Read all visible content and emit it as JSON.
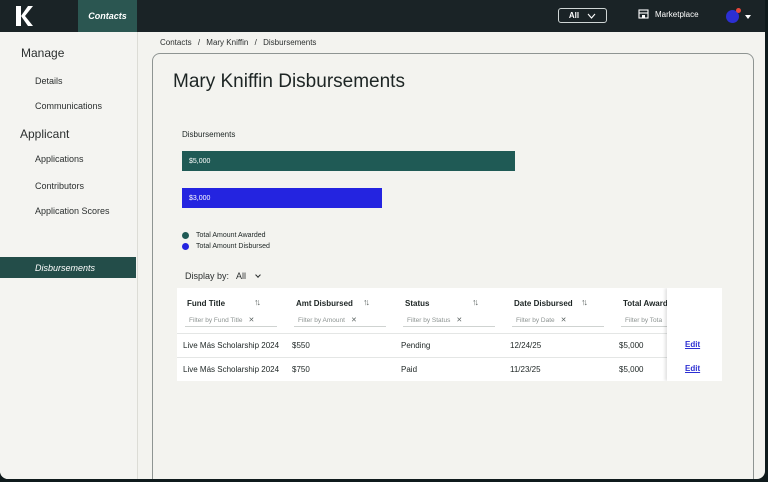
{
  "topbar": {
    "nav_contacts": "Contacts",
    "scope_select": "All",
    "marketplace": "Marketplace"
  },
  "sidebar": {
    "sections": [
      {
        "heading": "Manage",
        "items": [
          "Details",
          "Communications"
        ]
      },
      {
        "heading": "Applicant",
        "items": [
          "Applications",
          "Contributors",
          "Application Scores"
        ]
      }
    ],
    "active_item": "Disbursements"
  },
  "breadcrumb": [
    "Contacts",
    "Mary Kniffin",
    "Disbursements"
  ],
  "breadcrumb_sep": "/",
  "page": {
    "title": "Mary Kniffin Disbursements"
  },
  "chart_data": {
    "type": "bar",
    "orientation": "horizontal",
    "title": "Disbursements",
    "categories": [
      "Total Amount Awarded",
      "Total Amount Disbursed"
    ],
    "values": [
      5000,
      3000
    ],
    "value_labels": [
      "$5,000",
      "$3,000"
    ],
    "colors": [
      "#1f5a55",
      "#2424e0"
    ],
    "legend_position": "bottom-left"
  },
  "display_by": {
    "label": "Display by:",
    "value": "All"
  },
  "table": {
    "columns": [
      {
        "label": "Fund Title",
        "filter": "Filter by Fund Title"
      },
      {
        "label": "Amt Disbursed",
        "filter": "Filter by Amount"
      },
      {
        "label": "Status",
        "filter": "Filter by Status"
      },
      {
        "label": "Date Disbursed",
        "filter": "Filter by Date"
      },
      {
        "label": "Total Award",
        "filter": "Filter by Tota"
      }
    ],
    "rows": [
      {
        "fund": "Live Más Scholarship 2024",
        "amount": "$550",
        "status": "Pending",
        "date": "12/24/25",
        "total": "$5,000",
        "action": "Edit"
      },
      {
        "fund": "Live Más Scholarship 2024",
        "amount": "$750",
        "status": "Paid",
        "date": "11/23/25",
        "total": "$5,000",
        "action": "Edit"
      }
    ]
  }
}
